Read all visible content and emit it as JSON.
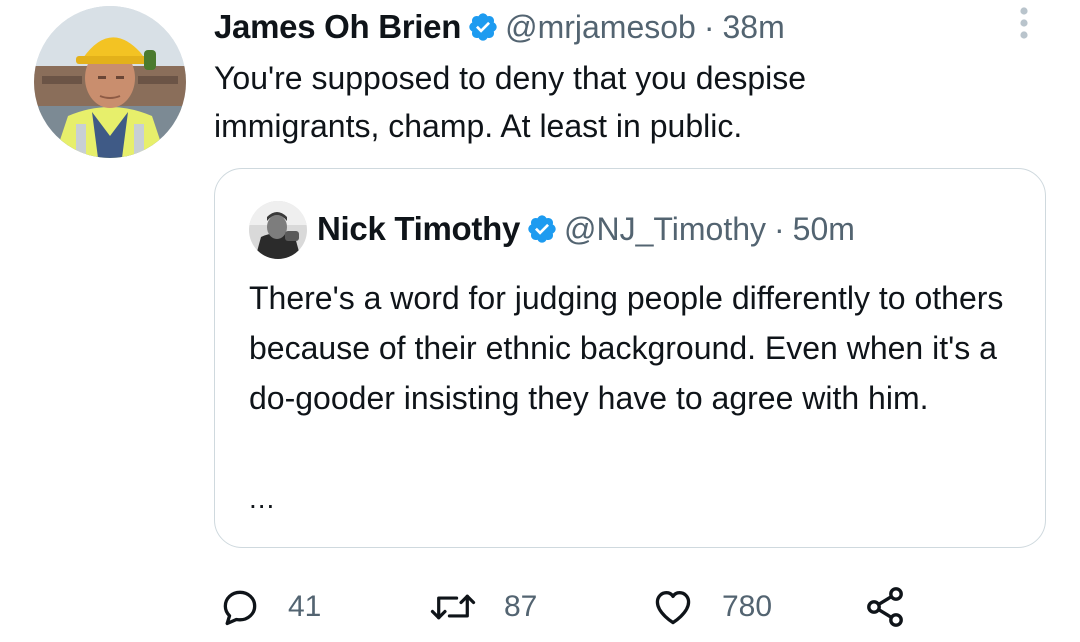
{
  "tweet": {
    "author": {
      "display_name": "James Oh Brien",
      "handle": "@mrjamesob",
      "verified": true,
      "avatar_icon": "profile-photo-hard-hat"
    },
    "separator": "·",
    "time": "38m",
    "text": "You're supposed to deny that you despise immigrants, champ. At least in public.",
    "more_icon": "vertical-ellipsis-icon"
  },
  "quoted_tweet": {
    "author": {
      "display_name": "Nick Timothy",
      "handle": "@NJ_Timothy",
      "verified": true,
      "avatar_icon": "profile-photo-grayscale"
    },
    "separator": "·",
    "time": "50m",
    "text": "There's a word for judging people differently to others because of their ethnic background. Even when it's a do-gooder insisting they have to agree with him.",
    "truncation": "..."
  },
  "actions": {
    "reply": {
      "icon": "reply-icon",
      "count": "41"
    },
    "retweet": {
      "icon": "retweet-icon",
      "count": "87"
    },
    "like": {
      "icon": "heart-icon",
      "count": "780"
    },
    "share": {
      "icon": "share-icon"
    }
  },
  "colors": {
    "text_primary": "#0f1419",
    "text_secondary": "#536471",
    "verified_blue": "#1d9bf0",
    "border": "#cfd9de"
  }
}
